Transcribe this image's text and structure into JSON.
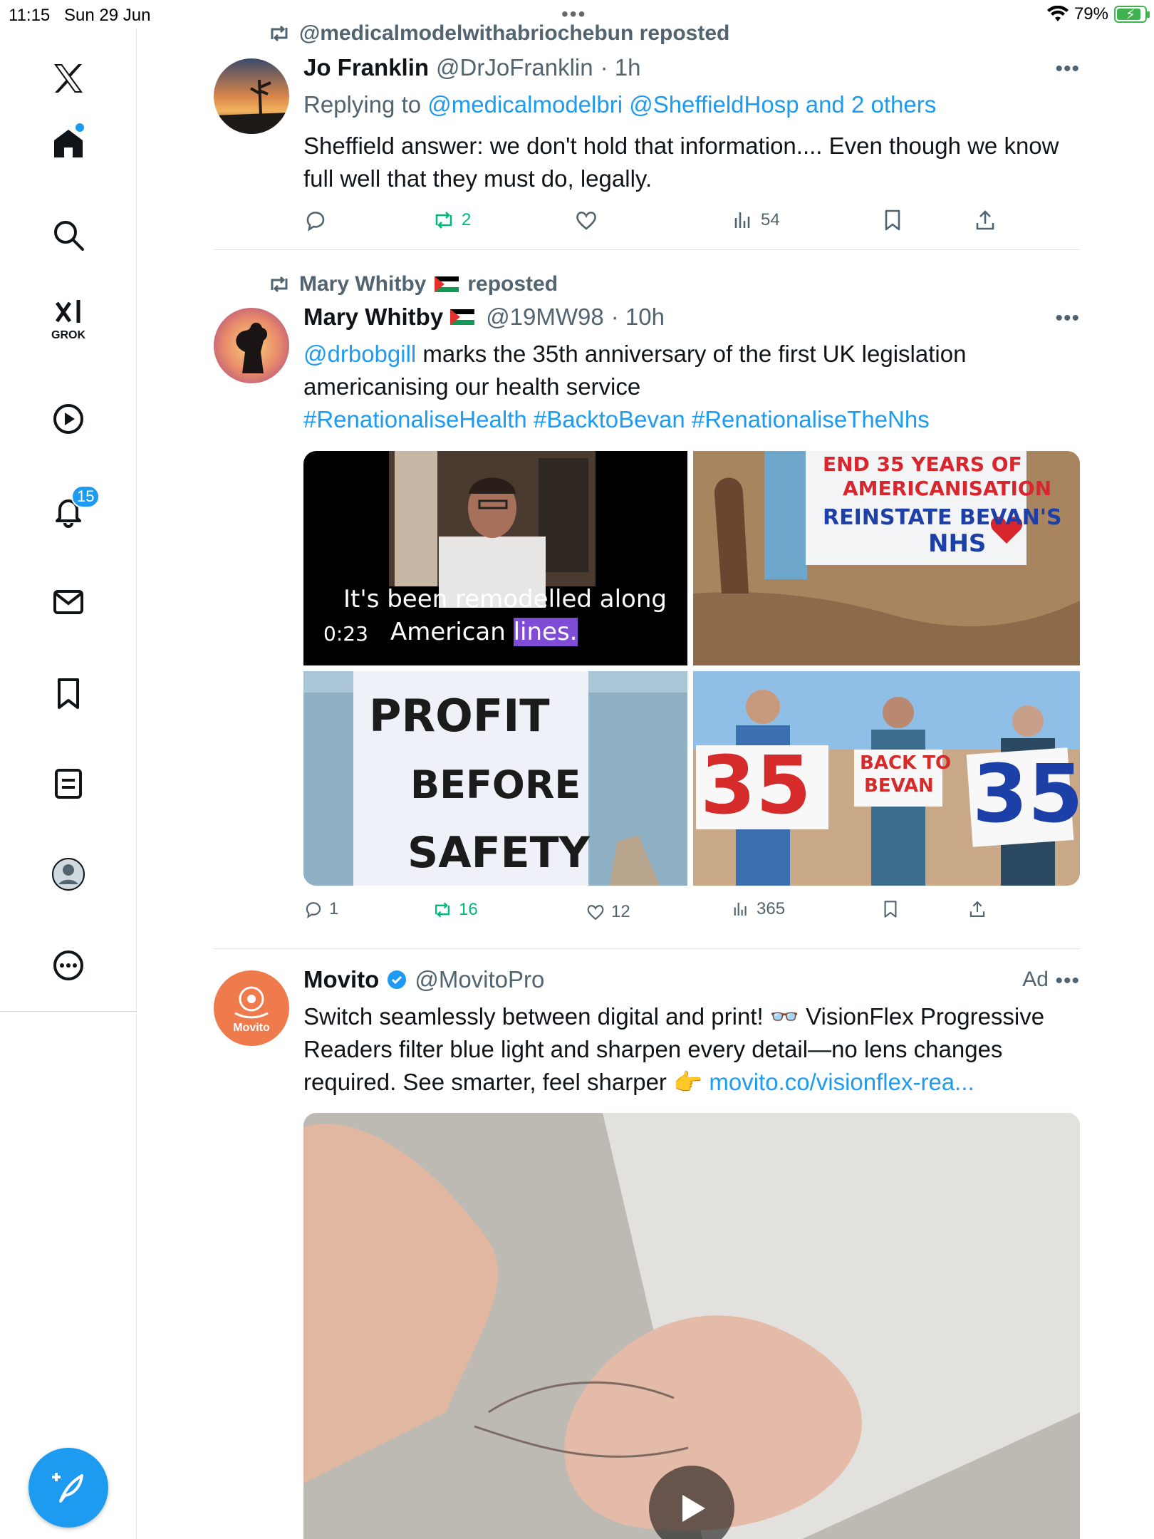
{
  "status_bar": {
    "time": "11:15",
    "date": "Sun 29 Jun",
    "battery": "79%",
    "battery_level": 0.79
  },
  "sidebar": {
    "grok_label": "GROK",
    "notification_count": "15"
  },
  "tweets": [
    {
      "repost_by": "@medicalmodelwithabriochebun reposted",
      "name": "Jo Franklin",
      "handle": "@DrJoFranklin",
      "time": "· 1h",
      "replying_prefix": "Replying to ",
      "replying_to": "@medicalmodelbri @SheffieldHosp and 2 others",
      "text": "Sheffield answer: we don't hold that information.... Even though we know full well that they must do, legally.",
      "reposts": "2",
      "views": "54"
    },
    {
      "repost_by": "Mary Whitby",
      "repost_suffix": "reposted",
      "name": "Mary Whitby",
      "handle": "@19MW98",
      "time": "· 10h",
      "mention": "@drbobgill",
      "text": " marks the 35th anniversary of the first UK legislation americanising our health service",
      "hashtags": "#RenationaliseHealth #BacktoBevan #RenationaliseTheNhs",
      "video_caption_1": "It's been remodelled along",
      "video_caption_2a": "American ",
      "video_caption_2b": "lines.",
      "video_time": "0:23",
      "banner_1": "END 35 YEARS OF",
      "banner_2": "AMERICANISATION",
      "banner_3": "REINSTATE BEVAN'S",
      "banner_4": "NHS",
      "sign_1": "PROFIT",
      "sign_2": "BEFORE",
      "sign_3": "SAFETY",
      "sign_35a": "35",
      "sign_back_1": "BACK TO",
      "sign_back_2": "BEVAN",
      "sign_35b": "35",
      "replies": "1",
      "reposts": "16",
      "likes": "12",
      "views": "365"
    },
    {
      "name": "Movito",
      "handle": "@MovitoPro",
      "ad_label": "Ad",
      "avatar_text": "Movito",
      "text": "Switch seamlessly between digital and print! 👓 VisionFlex Progressive Readers filter blue light and sharpen every detail—no lens changes required. See smarter, feel sharper 👉 ",
      "link": "movito.co/visionflex-rea..."
    }
  ],
  "colors": {
    "accent": "#1d9bf0",
    "repost_green": "#00ba7c",
    "text": "#0f1419",
    "muted": "#536471"
  }
}
